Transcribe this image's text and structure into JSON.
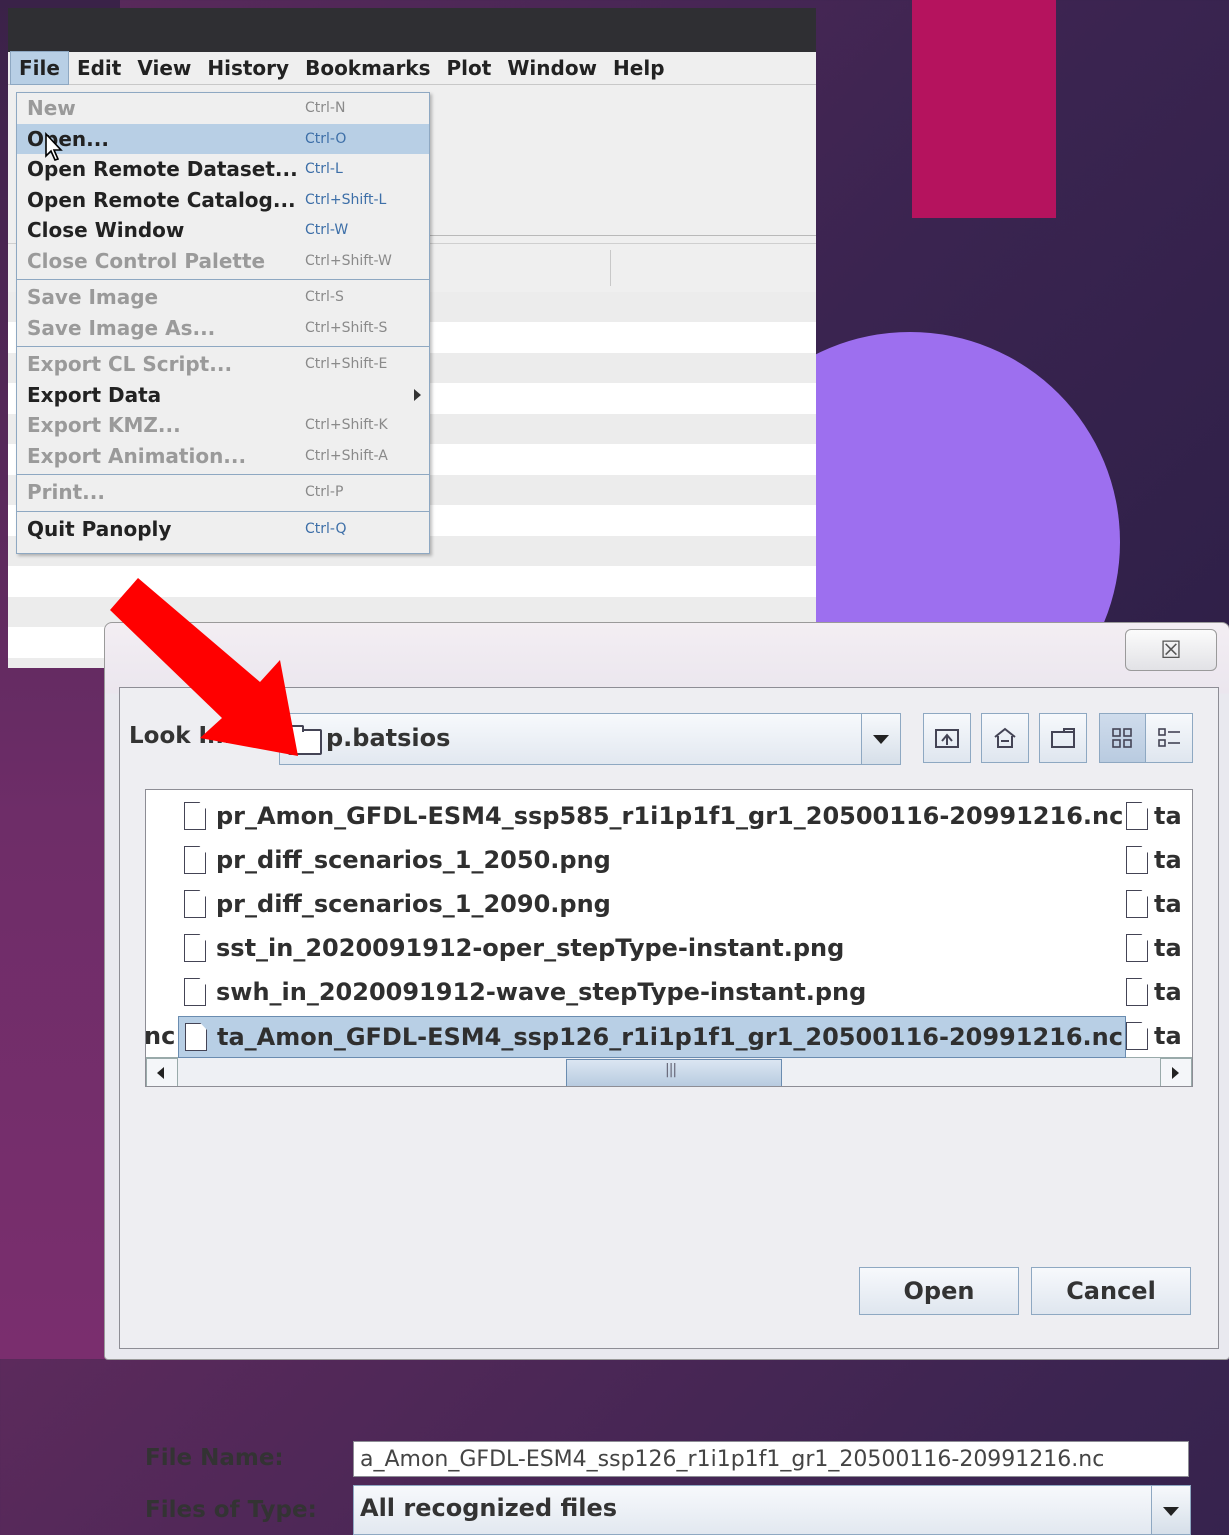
{
  "menubar": {
    "items": [
      "File",
      "Edit",
      "View",
      "History",
      "Bookmarks",
      "Plot",
      "Window",
      "Help"
    ],
    "active": "File"
  },
  "file_menu": {
    "groups": [
      [
        {
          "label": "New",
          "shortcut": "Ctrl-N",
          "enabled": false
        },
        {
          "label": "Open...",
          "shortcut": "Ctrl-O",
          "enabled": true,
          "highlighted": true
        },
        {
          "label": "Open Remote Dataset...",
          "shortcut": "Ctrl-L",
          "enabled": true
        },
        {
          "label": "Open Remote Catalog...",
          "shortcut": "Ctrl+Shift-L",
          "enabled": true
        },
        {
          "label": "Close Window",
          "shortcut": "Ctrl-W",
          "enabled": true
        },
        {
          "label": "Close Control Palette",
          "shortcut": "Ctrl+Shift-W",
          "enabled": false
        }
      ],
      [
        {
          "label": "Save Image",
          "shortcut": "Ctrl-S",
          "enabled": false
        },
        {
          "label": "Save Image As...",
          "shortcut": "Ctrl+Shift-S",
          "enabled": false
        }
      ],
      [
        {
          "label": "Export CL Script...",
          "shortcut": "Ctrl+Shift-E",
          "enabled": false
        },
        {
          "label": "Export Data",
          "shortcut": "",
          "enabled": true,
          "submenu": true
        },
        {
          "label": "Export KMZ...",
          "shortcut": "Ctrl+Shift-K",
          "enabled": false
        },
        {
          "label": "Export Animation...",
          "shortcut": "Ctrl+Shift-A",
          "enabled": false
        }
      ],
      [
        {
          "label": "Print...",
          "shortcut": "Ctrl-P",
          "enabled": false
        }
      ],
      [
        {
          "label": "Quit Panoply",
          "shortcut": "Ctrl-Q",
          "enabled": true
        }
      ]
    ]
  },
  "dialog": {
    "close_glyph": "☒",
    "look_in_label": "Look In:",
    "look_in_value": "p.batsios",
    "files": [
      "pr_Amon_GFDL-ESM4_ssp585_r1i1p1f1_gr1_20500116-20991216.nc",
      "pr_diff_scenarios_1_2050.png",
      "pr_diff_scenarios_1_2090.png",
      "sst_in_2020091912-oper_stepType-instant.png",
      "swh_in_2020091912-wave_stepType-instant.png",
      "ta_Amon_GFDL-ESM4_ssp126_r1i1p1f1_gr1_20500116-20991216.nc"
    ],
    "selected_index": 5,
    "second_column_prefix": "ta",
    "prev_column_suffix": "nc",
    "file_name_label": "File Name:",
    "file_name_value": "a_Amon_GFDL-ESM4_ssp126_r1i1p1f1_gr1_20500116-20991216.nc",
    "files_of_type_label": "Files of Type:",
    "files_of_type_value": "All recognized files",
    "open_label": "Open",
    "cancel_label": "Cancel"
  },
  "colors": {
    "menu_highlight": "#b8cfe5",
    "accent_magenta": "#b5135e",
    "accent_purple": "#9d6fef",
    "arrow_red": "#ff0000"
  }
}
